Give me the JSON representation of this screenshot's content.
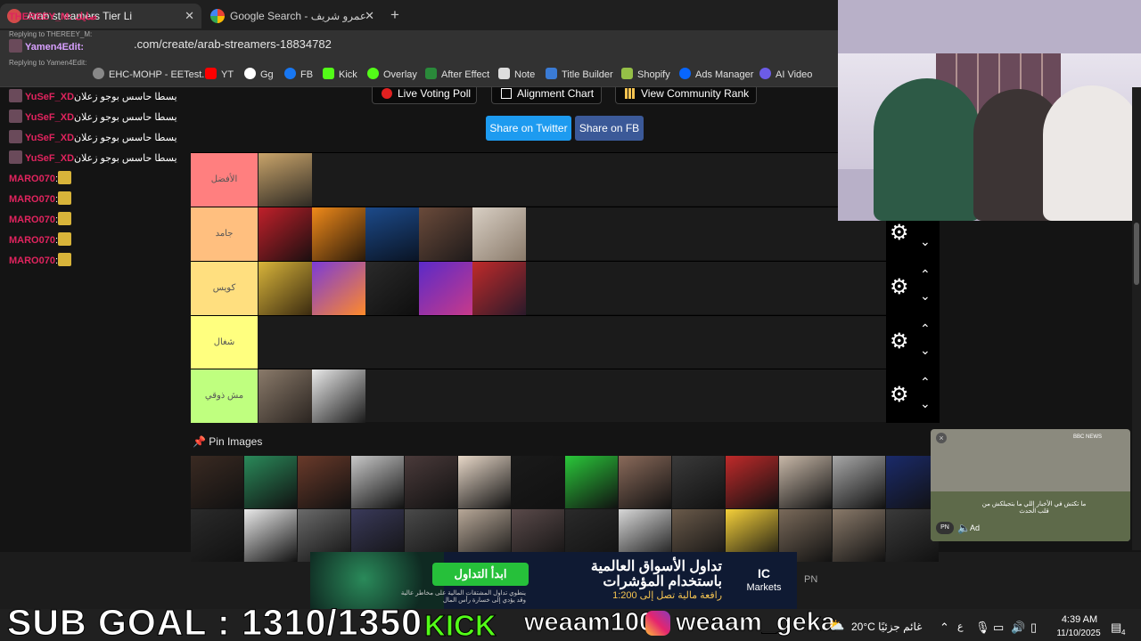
{
  "browser": {
    "tabs": [
      {
        "label": "Arab streamers Tier Li",
        "active": true
      },
      {
        "label": "Google Search - عمرو شريف",
        "active": false
      }
    ],
    "new_tab": "+",
    "close": "✕",
    "url": ".com/create/arab-streamers-18834782",
    "bookmarks": [
      "EHC-MOHP - EETest...",
      "YT",
      "Gg",
      "FB",
      "Kick",
      "Overlay",
      "After Effect",
      "Note",
      "Title Builder",
      "Shopify",
      "Ads Manager",
      "AI Video"
    ]
  },
  "chat": {
    "overlay_top": "THEREEY_M: صايك",
    "overlay_user": "Yamen4Edit:",
    "reply1": "Replying to THEREEY_M:",
    "reply2": "Replying to Yamen4Edit:",
    "lines": [
      {
        "user": "YuSeF_XD",
        "msg": "يسطا حاسس بوجو زعلان"
      },
      {
        "user": "YuSeF_XD",
        "msg": "يسطا حاسس بوجو زعلان"
      },
      {
        "user": "YuSeF_XD",
        "msg": "يسطا حاسس بوجو زعلان"
      },
      {
        "user": "YuSeF_XD",
        "msg": "يسطا حاسس بوجو زعلان"
      },
      {
        "user": "MARO070",
        "msg": ":"
      },
      {
        "user": "MARO070",
        "msg": ":"
      },
      {
        "user": "MARO070",
        "msg": ":"
      },
      {
        "user": "MARO070",
        "msg": ":"
      },
      {
        "user": "MARO070",
        "msg": ":"
      }
    ]
  },
  "page": {
    "buttons": {
      "live_poll": "Live Voting Poll",
      "alignment": "Alignment Chart",
      "community": "View Community Rank",
      "share_twitter": "Share on Twitter",
      "share_fb": "Share on FB"
    },
    "tiers": [
      {
        "label": "الأفضل",
        "color": "#ff7f7f",
        "count": 1
      },
      {
        "label": "جامد",
        "color": "#ffbf7f",
        "count": 5
      },
      {
        "label": "كويس",
        "color": "#ffdf7f",
        "count": 5
      },
      {
        "label": "شغال",
        "color": "#ffff7f",
        "count": 0
      },
      {
        "label": "مش ذوقي",
        "color": "#bfff7f",
        "count": 2
      }
    ],
    "gear": "⚙",
    "up": "⌃",
    "down": "⌄",
    "pin_title": "Pin Images"
  },
  "news_video": {
    "badge": "BBC NEWS",
    "caption": "ما تكتش في الأخبار إللي ما بتجيلكش من قلب الحدث",
    "ad": "Ad"
  },
  "ad": {
    "title1": "تداول الأسواق العالمية",
    "title2": "باستخدام المؤشرات",
    "subtitle": "رافعة مالية تصل إلى 1:200",
    "cta": "ابدأ التداول",
    "small": "ينطوي تداول المشتقات المالية على مخاطر عالية وقد يؤدي إلى خسارة رأس المال",
    "brand1": "IC",
    "brand2": "Markets",
    "pn": "PN"
  },
  "overlay": {
    "sub_goal": "SUB GOAL : 1310/1350",
    "kick": "KICK",
    "tiktok": "weaam100",
    "instagram": "weaam_geka"
  },
  "taskbar": {
    "weather": "20°C  غائم جزئيًا",
    "time": "4:39 AM",
    "date": "11/10/2025",
    "lang": "ع",
    "notif": "4"
  }
}
